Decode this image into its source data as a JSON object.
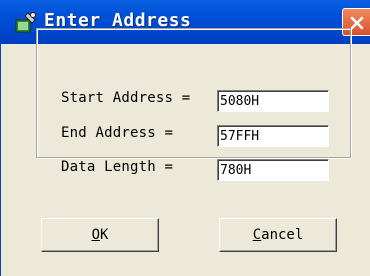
{
  "window": {
    "title": "Enter Address",
    "icon": "wrench-window-icon",
    "close_icon": "close-icon"
  },
  "form": {
    "start_label": "Start Address =",
    "start_value": "5080H",
    "end_label": "End Address =",
    "end_value": "57FFH",
    "length_label": "Data Length =",
    "length_value": "780H"
  },
  "buttons": {
    "ok_mnemonic": "O",
    "ok_rest": "K",
    "cancel_mnemonic": "C",
    "cancel_rest": "ancel"
  },
  "colors": {
    "title_bar": "#0050d8",
    "close_button": "#d8512a",
    "dialog_face": "#ece9d8"
  }
}
